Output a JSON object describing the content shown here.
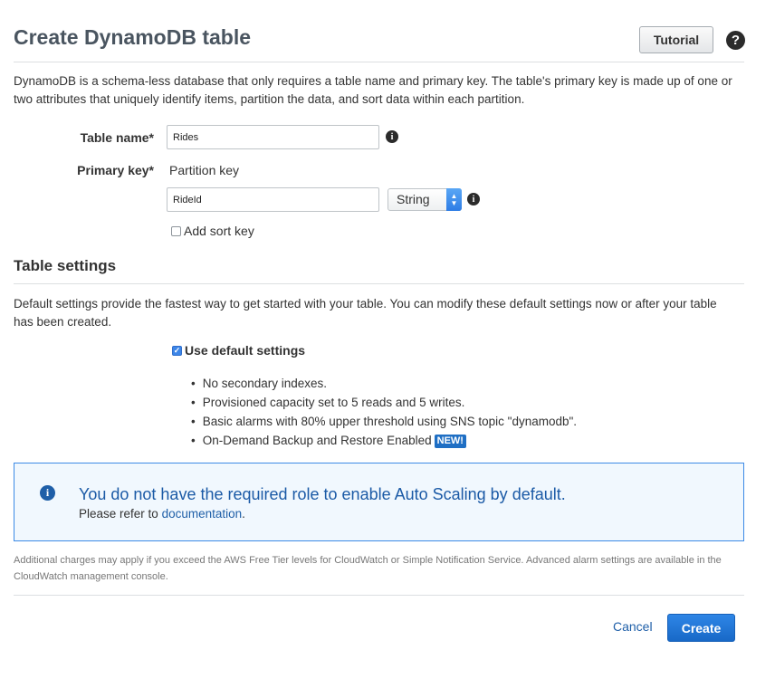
{
  "header": {
    "title": "Create DynamoDB table",
    "tutorial_label": "Tutorial",
    "help_icon": "question-circle-icon"
  },
  "intro": "DynamoDB is a schema-less database that only requires a table name and primary key. The table's primary key is made up of one or two attributes that uniquely identify items, partition the data, and sort data within each partition.",
  "form": {
    "table_name_label": "Table name*",
    "table_name_value": "Rides",
    "primary_key_label": "Primary key*",
    "partition_key_label": "Partition key",
    "partition_key_value": "RideId",
    "partition_key_type": "String",
    "add_sort_key_label": "Add sort key",
    "add_sort_key_checked": false
  },
  "table_settings": {
    "title": "Table settings",
    "description": "Default settings provide the fastest way to get started with your table. You can modify these default settings now or after your table has been created.",
    "use_default_label": "Use default settings",
    "use_default_checked": true,
    "bullets": [
      "No secondary indexes.",
      "Provisioned capacity set to 5 reads and 5 writes.",
      "Basic alarms with 80% upper threshold using SNS topic \"dynamodb\".",
      "On-Demand Backup and Restore Enabled"
    ],
    "new_badge": "NEW!"
  },
  "alert": {
    "icon": "info-circle-icon",
    "title": "You do not have the required role to enable Auto Scaling by default.",
    "body_prefix": "Please refer to",
    "link_text": "documentation",
    "body_suffix": "."
  },
  "footnote": "Additional charges may apply if you exceed the AWS Free Tier levels for CloudWatch or Simple Notification Service. Advanced alarm settings are available in the CloudWatch management console.",
  "actions": {
    "cancel_label": "Cancel",
    "create_label": "Create"
  },
  "colors": {
    "primary_button": "#1869c7",
    "link": "#1f5fa8",
    "alert_border": "#3c8ae6",
    "alert_background": "#f1f8fe"
  }
}
